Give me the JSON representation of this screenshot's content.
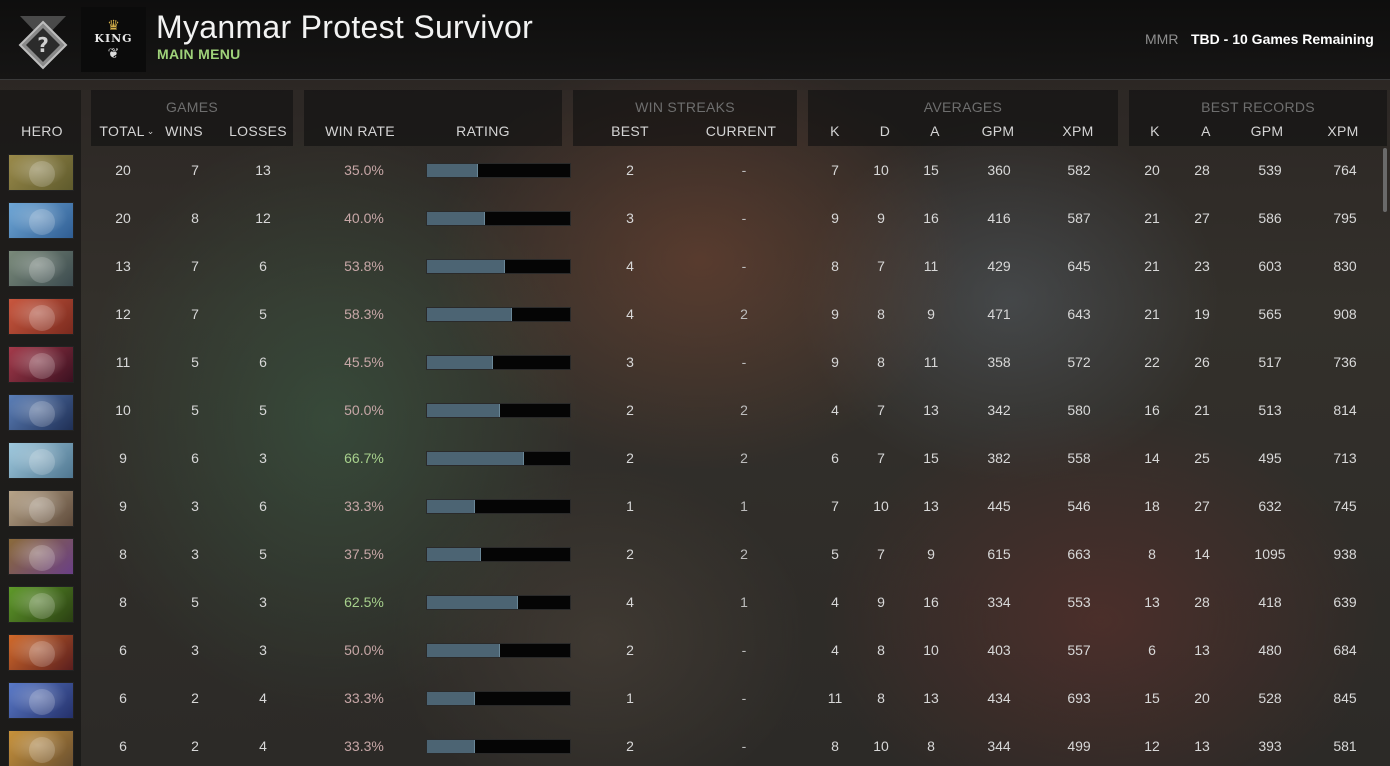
{
  "header": {
    "player_name": "Myanmar Protest Survivor",
    "menu_link": "MAIN MENU",
    "mmr_label": "MMR",
    "mmr_value": "TBD - 10 Games Remaining",
    "rank_badge_icon": "uncalibrated-rank-icon",
    "rank_badge_symbol": "?",
    "avatar_icon": "king-crown-logo-avatar"
  },
  "groups": {
    "games": "GAMES",
    "win_streaks": "WIN STREAKS",
    "averages": "AVERAGES",
    "best_records": "BEST RECORDS"
  },
  "columns": {
    "hero": "HERO",
    "total": "TOTAL",
    "wins": "WINS",
    "losses": "LOSSES",
    "win_rate": "WIN RATE",
    "rating": "RATING",
    "best": "BEST",
    "current": "CURRENT",
    "avg_k": "K",
    "avg_d": "D",
    "avg_a": "A",
    "avg_gpm": "GPM",
    "avg_xpm": "XPM",
    "best_k": "K",
    "best_a": "A",
    "best_gpm": "GPM",
    "best_xpm": "XPM"
  },
  "colors": {
    "accent_green": "#9fd27a",
    "rating_fill": "#4c6473",
    "good_rate": "#a7d08c",
    "bad_rate": "#c7a7a7"
  },
  "heroes": [
    {
      "icon": "pudge-portrait",
      "colors": [
        "#9a8a4a",
        "#5e5a2c"
      ],
      "total": "20",
      "wins": "7",
      "losses": "13",
      "win_rate": "35.0%",
      "rating": 0.35,
      "best": "2",
      "current": "-",
      "k": "7",
      "d": "10",
      "a": "15",
      "gpm": "360",
      "xpm": "582",
      "bk": "20",
      "ba": "28",
      "bgpm": "539",
      "bxpm": "764"
    },
    {
      "icon": "zeus-portrait",
      "colors": [
        "#6fa7d6",
        "#2f5d93"
      ],
      "total": "20",
      "wins": "8",
      "losses": "12",
      "win_rate": "40.0%",
      "rating": 0.4,
      "best": "3",
      "current": "-",
      "k": "9",
      "d": "9",
      "a": "16",
      "gpm": "416",
      "xpm": "587",
      "bk": "21",
      "ba": "27",
      "bgpm": "586",
      "bxpm": "795"
    },
    {
      "icon": "clockwerk-portrait",
      "colors": [
        "#7a8a7a",
        "#3b4a4e"
      ],
      "total": "13",
      "wins": "7",
      "losses": "6",
      "win_rate": "53.8%",
      "rating": 0.538,
      "best": "4",
      "current": "-",
      "k": "8",
      "d": "7",
      "a": "11",
      "gpm": "429",
      "xpm": "645",
      "bk": "21",
      "ba": "23",
      "bgpm": "603",
      "bxpm": "830"
    },
    {
      "icon": "axe-portrait",
      "colors": [
        "#c9573e",
        "#7a2a1e"
      ],
      "total": "12",
      "wins": "7",
      "losses": "5",
      "win_rate": "58.3%",
      "rating": 0.583,
      "best": "4",
      "current": "2",
      "k": "9",
      "d": "8",
      "a": "9",
      "gpm": "471",
      "xpm": "643",
      "bk": "21",
      "ba": "19",
      "bgpm": "565",
      "bxpm": "908"
    },
    {
      "icon": "lion-portrait",
      "colors": [
        "#a43a4a",
        "#3a1020"
      ],
      "total": "11",
      "wins": "5",
      "losses": "6",
      "win_rate": "45.5%",
      "rating": 0.455,
      "best": "3",
      "current": "-",
      "k": "9",
      "d": "8",
      "a": "11",
      "gpm": "358",
      "xpm": "572",
      "bk": "22",
      "ba": "26",
      "bgpm": "517",
      "bxpm": "736"
    },
    {
      "icon": "vengeful-spirit-portrait",
      "colors": [
        "#5b7fb8",
        "#1f2f55"
      ],
      "total": "10",
      "wins": "5",
      "losses": "5",
      "win_rate": "50.0%",
      "rating": 0.5,
      "best": "2",
      "current": "2",
      "k": "4",
      "d": "7",
      "a": "13",
      "gpm": "342",
      "xpm": "580",
      "bk": "16",
      "ba": "21",
      "bgpm": "513",
      "bxpm": "814"
    },
    {
      "icon": "crystal-maiden-portrait",
      "colors": [
        "#9fc9de",
        "#4f7690"
      ],
      "total": "9",
      "wins": "6",
      "losses": "3",
      "win_rate": "66.7%",
      "rating": 0.667,
      "best": "2",
      "current": "2",
      "k": "6",
      "d": "7",
      "a": "15",
      "gpm": "382",
      "xpm": "558",
      "bk": "14",
      "ba": "25",
      "bgpm": "495",
      "bxpm": "713"
    },
    {
      "icon": "sniper-portrait",
      "colors": [
        "#b8a58a",
        "#5e4a3a"
      ],
      "total": "9",
      "wins": "3",
      "losses": "6",
      "win_rate": "33.3%",
      "rating": 0.333,
      "best": "1",
      "current": "1",
      "k": "7",
      "d": "10",
      "a": "13",
      "gpm": "445",
      "xpm": "546",
      "bk": "18",
      "ba": "27",
      "bgpm": "632",
      "bxpm": "745"
    },
    {
      "icon": "alchemist-portrait",
      "colors": [
        "#8a6a3a",
        "#6a3f86"
      ],
      "total": "8",
      "wins": "3",
      "losses": "5",
      "win_rate": "37.5%",
      "rating": 0.375,
      "best": "2",
      "current": "2",
      "k": "5",
      "d": "7",
      "a": "9",
      "gpm": "615",
      "xpm": "663",
      "bk": "8",
      "ba": "14",
      "bgpm": "1095",
      "bxpm": "938"
    },
    {
      "icon": "venomancer-portrait",
      "colors": [
        "#5f9a2a",
        "#2a3f12"
      ],
      "total": "8",
      "wins": "5",
      "losses": "3",
      "win_rate": "62.5%",
      "rating": 0.625,
      "best": "4",
      "current": "1",
      "k": "4",
      "d": "9",
      "a": "16",
      "gpm": "334",
      "xpm": "553",
      "bk": "13",
      "ba": "28",
      "bgpm": "418",
      "bxpm": "639"
    },
    {
      "icon": "dragon-knight-portrait",
      "colors": [
        "#d26a2a",
        "#5a1e1e"
      ],
      "total": "6",
      "wins": "3",
      "losses": "3",
      "win_rate": "50.0%",
      "rating": 0.5,
      "best": "2",
      "current": "-",
      "k": "4",
      "d": "8",
      "a": "10",
      "gpm": "403",
      "xpm": "557",
      "bk": "6",
      "ba": "13",
      "bgpm": "480",
      "bxpm": "684"
    },
    {
      "icon": "riki-portrait",
      "colors": [
        "#5a7ac8",
        "#24306a"
      ],
      "total": "6",
      "wins": "2",
      "losses": "4",
      "win_rate": "33.3%",
      "rating": 0.333,
      "best": "1",
      "current": "-",
      "k": "11",
      "d": "8",
      "a": "13",
      "gpm": "434",
      "xpm": "693",
      "bk": "15",
      "ba": "20",
      "bgpm": "528",
      "bxpm": "845"
    },
    {
      "icon": "tinker-portrait",
      "colors": [
        "#c8923a",
        "#6a5030"
      ],
      "total": "6",
      "wins": "2",
      "losses": "4",
      "win_rate": "33.3%",
      "rating": 0.333,
      "best": "2",
      "current": "-",
      "k": "8",
      "d": "10",
      "a": "8",
      "gpm": "344",
      "xpm": "499",
      "bk": "12",
      "ba": "13",
      "bgpm": "393",
      "bxpm": "581"
    }
  ]
}
